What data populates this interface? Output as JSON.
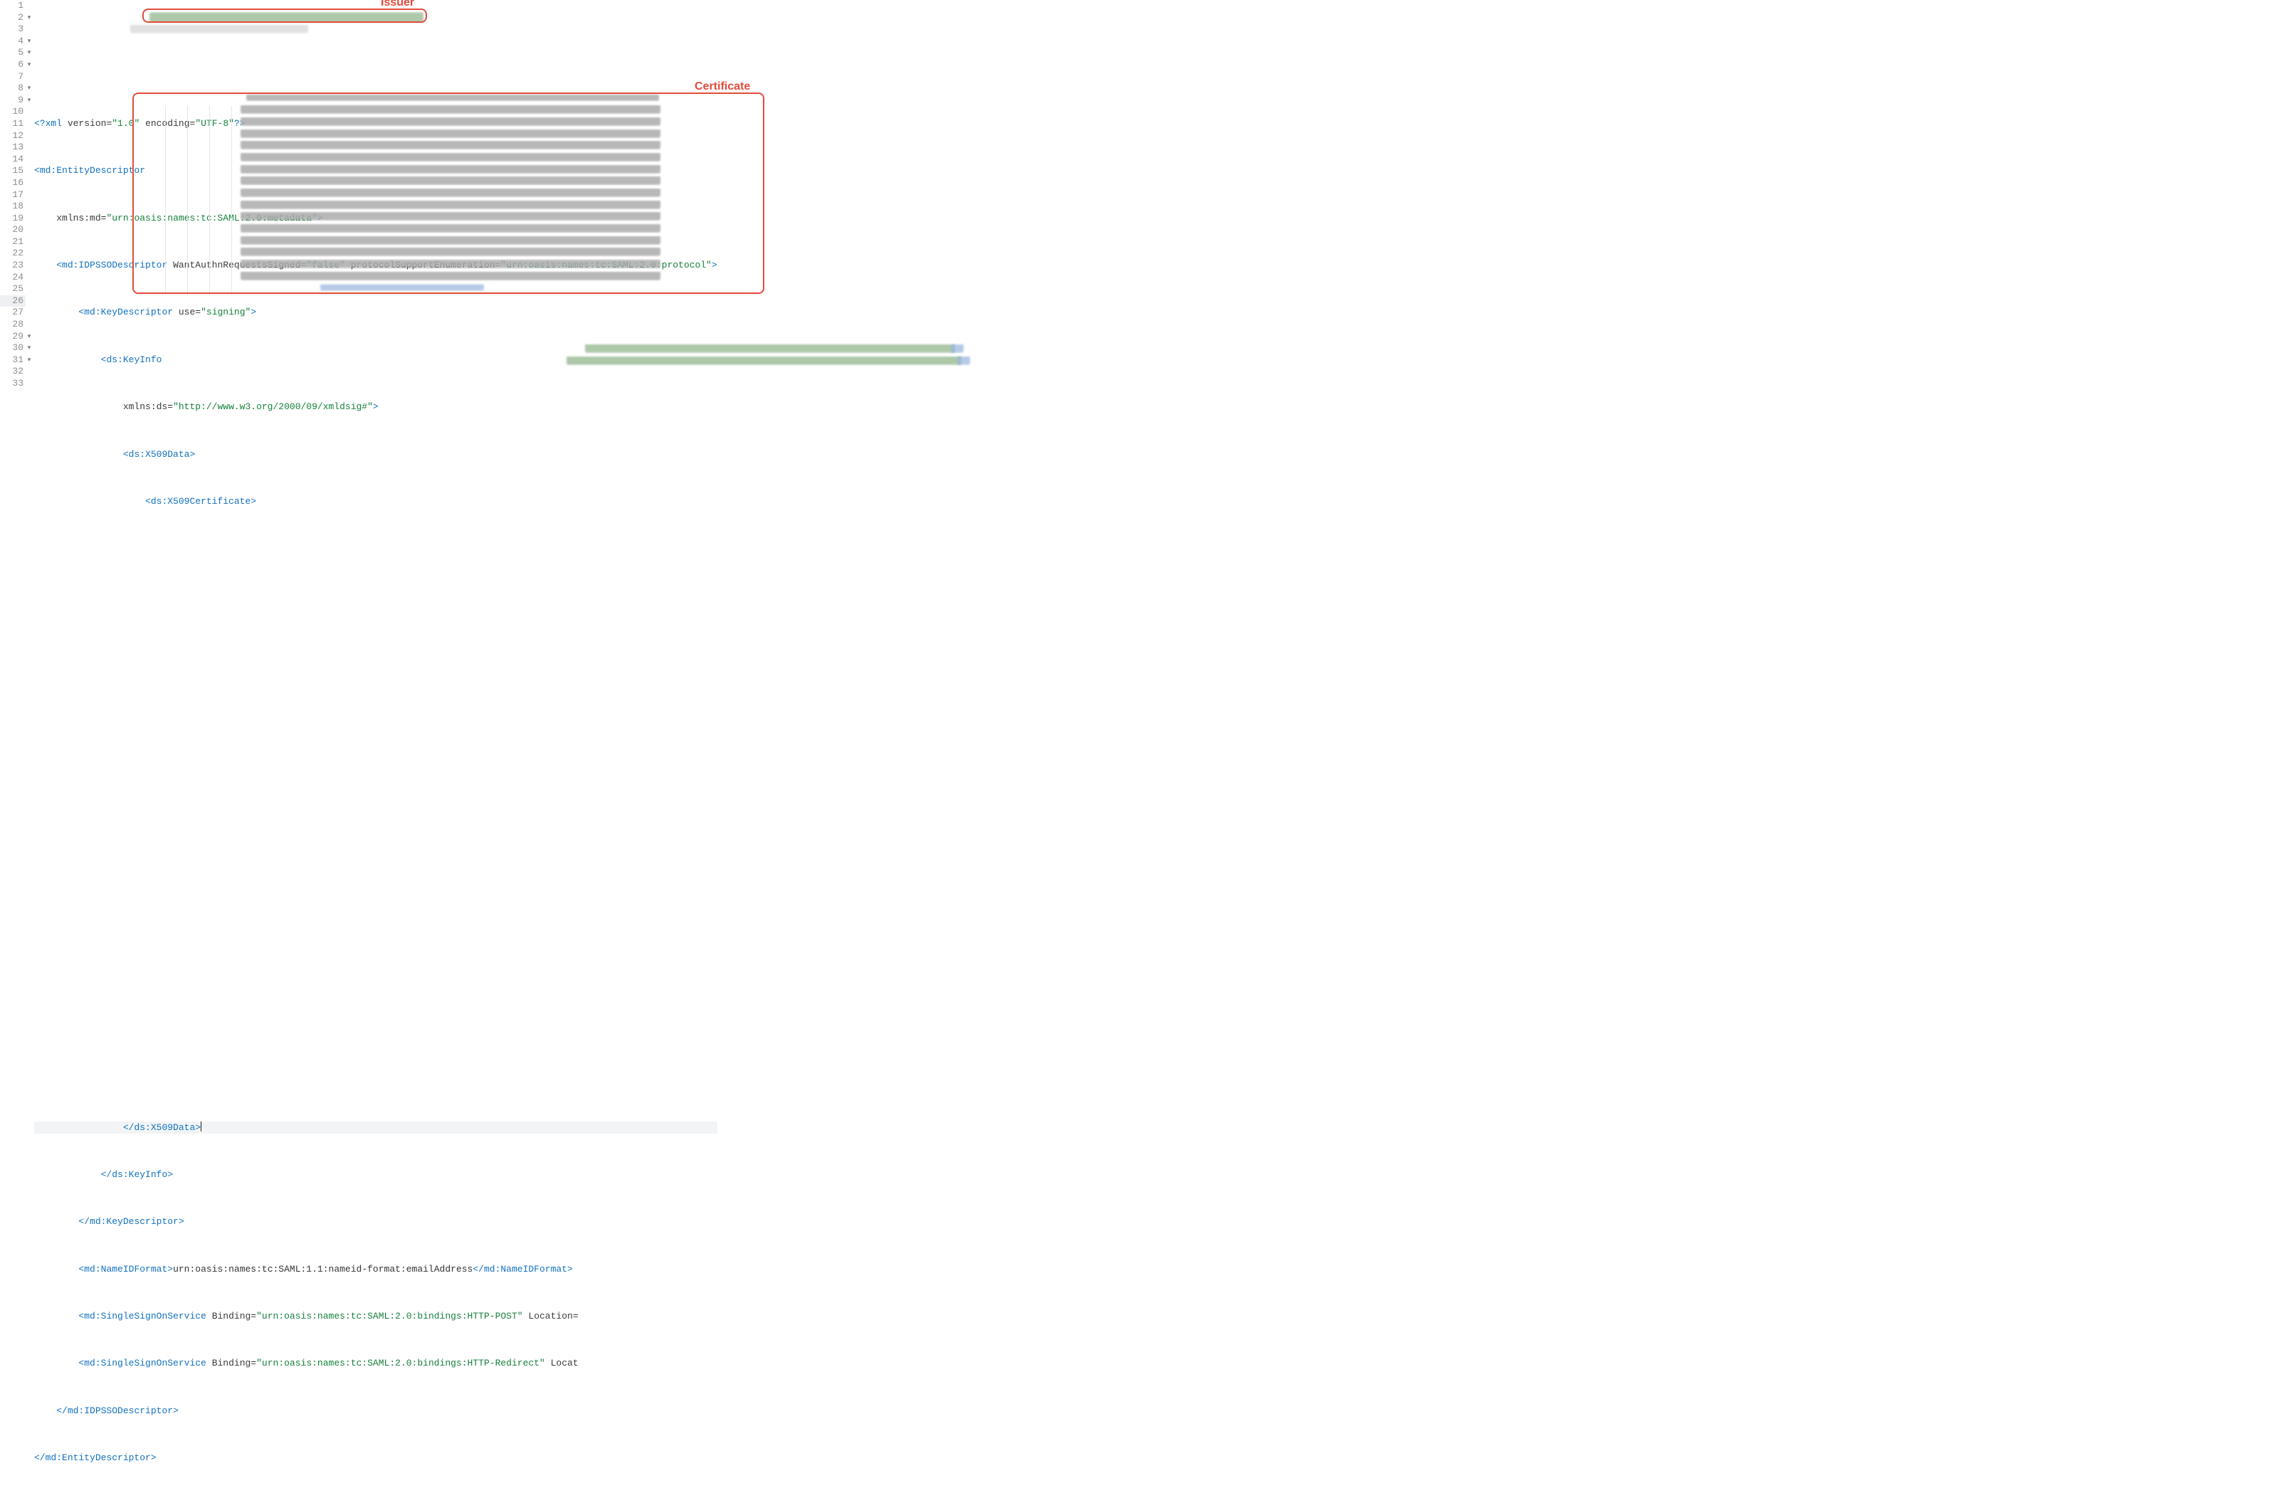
{
  "annotations": {
    "issuer_label": "Issuer",
    "certificate_label": "Certificate"
  },
  "line_numbers": [
    "1",
    "2",
    "3",
    "4",
    "5",
    "6",
    "7",
    "8",
    "9",
    "10",
    "11",
    "12",
    "13",
    "14",
    "15",
    "16",
    "17",
    "18",
    "19",
    "20",
    "21",
    "22",
    "23",
    "24",
    "25",
    "26",
    "27",
    "28",
    "29",
    "30",
    "31",
    "32",
    "33"
  ],
  "fold_lines": [
    2,
    4,
    5,
    6,
    8,
    9,
    29,
    30,
    31
  ],
  "highlight_line": 26,
  "lines": {
    "l1": {
      "pi_open": "<?",
      "pi_name": "xml",
      "attr1": "version",
      "val1": "\"1.0\"",
      "attr2": "encoding",
      "val2": "\"UTF-8\"",
      "pi_close": "?>"
    },
    "l2": {
      "open": "<",
      "name": "md:EntityDescriptor"
    },
    "l3": {
      "attr": "xmlns:md",
      "eq": "=",
      "val": "\"urn:oasis:names:tc:SAML:2.0:metadata\"",
      "close": ">"
    },
    "l4": {
      "open": "<",
      "name": "md:IDPSSODescriptor",
      "attr1": "WantAuthnRequestsSigned",
      "val1": "\"false\"",
      "attr2": "protocolSupportEnumeration",
      "val2": "\"urn:oasis:names:tc:SAML:2.0:protocol\"",
      "close": ">"
    },
    "l5": {
      "open": "<",
      "name": "md:KeyDescriptor",
      "attr1": "use",
      "val1": "\"signing\"",
      "close": ">"
    },
    "l6": {
      "open": "<",
      "name": "ds:KeyInfo"
    },
    "l7": {
      "attr": "xmlns:ds",
      "eq": "=",
      "val": "\"http://www.w3.org/2000/09/xmldsig#\"",
      "close": ">"
    },
    "l8": {
      "open": "<",
      "name": "ds:X509Data",
      "close": ">"
    },
    "l9": {
      "open": "<",
      "name": "ds:X509Certificate",
      "close": ">"
    },
    "l26": {
      "open": "</",
      "name": "ds:X509Data",
      "close": ">"
    },
    "l27": {
      "open": "</",
      "name": "ds:KeyInfo",
      "close": ">"
    },
    "l28": {
      "open": "</",
      "name": "md:KeyDescriptor",
      "close": ">"
    },
    "l29": {
      "open_a": "<",
      "name_a": "md:NameIDFormat",
      "close_a": ">",
      "text": "urn:oasis:names:tc:SAML:1.1:nameid-format:emailAddress",
      "open_b": "</",
      "name_b": "md:NameIDFormat",
      "close_b": ">"
    },
    "l30": {
      "open": "<",
      "name": "md:SingleSignOnService",
      "attr1": "Binding",
      "val1": "\"urn:oasis:names:tc:SAML:2.0:bindings:HTTP-POST\"",
      "attr2": "Location",
      "eq2": "="
    },
    "l31": {
      "open": "<",
      "name": "md:SingleSignOnService",
      "attr1": "Binding",
      "val1": "\"urn:oasis:names:tc:SAML:2.0:bindings:HTTP-Redirect\"",
      "attr2": "Locat"
    },
    "l32": {
      "open": "</",
      "name": "md:IDPSSODescriptor",
      "close": ">"
    },
    "l33": {
      "open": "</",
      "name": "md:EntityDescriptor",
      "close": ">"
    }
  },
  "colors": {
    "tag": "#1271c0",
    "string": "#17803d",
    "annotation": "#e24b3b"
  }
}
